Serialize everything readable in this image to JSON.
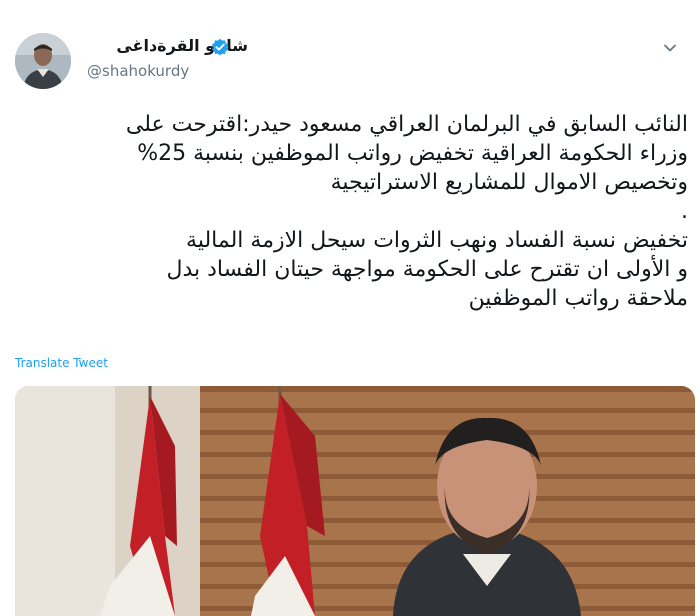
{
  "tweet": {
    "author": {
      "display_name": "شاهو القرةداغى",
      "handle": "@shahokurdy",
      "verified": true
    },
    "text_lines": [
      "النائب السابق في البرلمان العراقي مسعود حيدر:اقترحت على",
      "وزراء الحكومة العراقية تخفيض رواتب الموظفين بنسبة 25%",
      "وتخصيص الاموال للمشاريع الاستراتيجية",
      ".",
      "تخفيض نسبة الفساد ونهب الثروات سيحل الازمة المالية",
      "و الأولى ان تقترح على الحكومة مواجهة حيتان الفساد بدل",
      "ملاحقة رواتب الموظفين"
    ],
    "translate_label": "Translate Tweet"
  },
  "icons": {
    "verified": "verified-badge-icon",
    "menu": "chevron-down-icon"
  },
  "colors": {
    "accent": "#1da1f2",
    "text": "#14171a",
    "secondary_text": "#657786"
  }
}
